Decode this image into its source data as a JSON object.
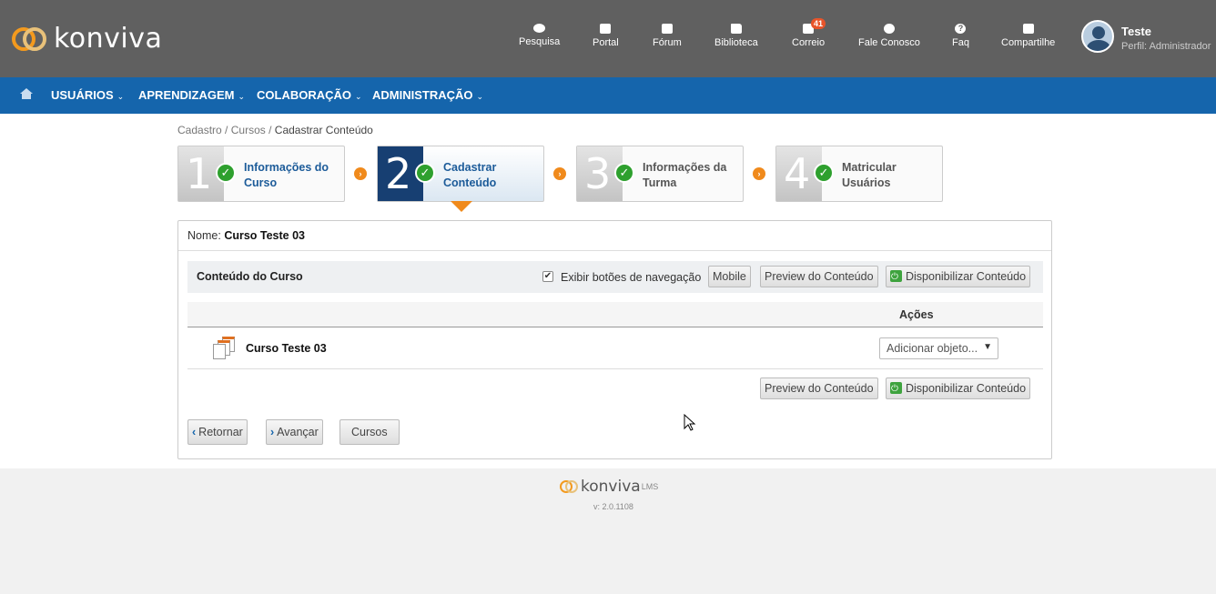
{
  "brand": {
    "logo_text": "konviva",
    "footer_logo_text": "konviva",
    "footer_sup": "LMS",
    "version": "v: 2.0.1108"
  },
  "topnav": [
    {
      "label": "Pesquisa",
      "icon": "chat-icon"
    },
    {
      "label": "Portal",
      "icon": "external-link-icon"
    },
    {
      "label": "Fórum",
      "icon": "forum-icon"
    },
    {
      "label": "Biblioteca",
      "icon": "folder-icon"
    },
    {
      "label": "Correio",
      "icon": "mail-icon",
      "badge": "41"
    },
    {
      "label": "Fale Conosco",
      "icon": "headset-icon"
    },
    {
      "label": "Faq",
      "icon": "question-icon"
    },
    {
      "label": "Compartilhe",
      "icon": "share-icon"
    }
  ],
  "user": {
    "name": "Teste",
    "profile": "Perfil: Administrador"
  },
  "menu": [
    {
      "label": "USUÁRIOS"
    },
    {
      "label": "APRENDIZAGEM"
    },
    {
      "label": "COLABORAÇÃO"
    },
    {
      "label": "ADMINISTRAÇÃO"
    }
  ],
  "breadcrumb": {
    "part1": "Cadastro",
    "sep": "/",
    "part2": "Cursos",
    "current": "Cadastrar Conteúdo"
  },
  "steps": [
    {
      "num": "1",
      "line1": "Informações do",
      "line2": "Curso",
      "state": "done"
    },
    {
      "num": "2",
      "line1": "Cadastrar",
      "line2": "Conteúdo",
      "state": "active"
    },
    {
      "num": "3",
      "line1": "Informações da",
      "line2": "Turma",
      "state": "inactive"
    },
    {
      "num": "4",
      "line1": "Matricular",
      "line2": "Usuários",
      "state": "inactive"
    }
  ],
  "course": {
    "name_label": "Nome:",
    "name_value": "Curso Teste 03"
  },
  "content": {
    "title": "Conteúdo do Curso",
    "nav_checkbox_label": "Exibir botões de navegação",
    "nav_checkbox_checked": true,
    "mobile_button": "Mobile",
    "preview_button": "Preview do Conteúdo",
    "publish_button": "Disponibilizar Conteúdo",
    "actions_header": "Ações",
    "rows": [
      {
        "name": "Curso Teste 03",
        "action_placeholder": "Adicionar objeto..."
      }
    ]
  },
  "nav": {
    "back": "Retornar",
    "next": "Avançar",
    "courses": "Cursos"
  },
  "colors": {
    "header_bg": "#606060",
    "menu_bg": "#1565ac",
    "accent_orange": "#f08a1c",
    "step_active": "#173f72",
    "check_green": "#2ea02e"
  }
}
